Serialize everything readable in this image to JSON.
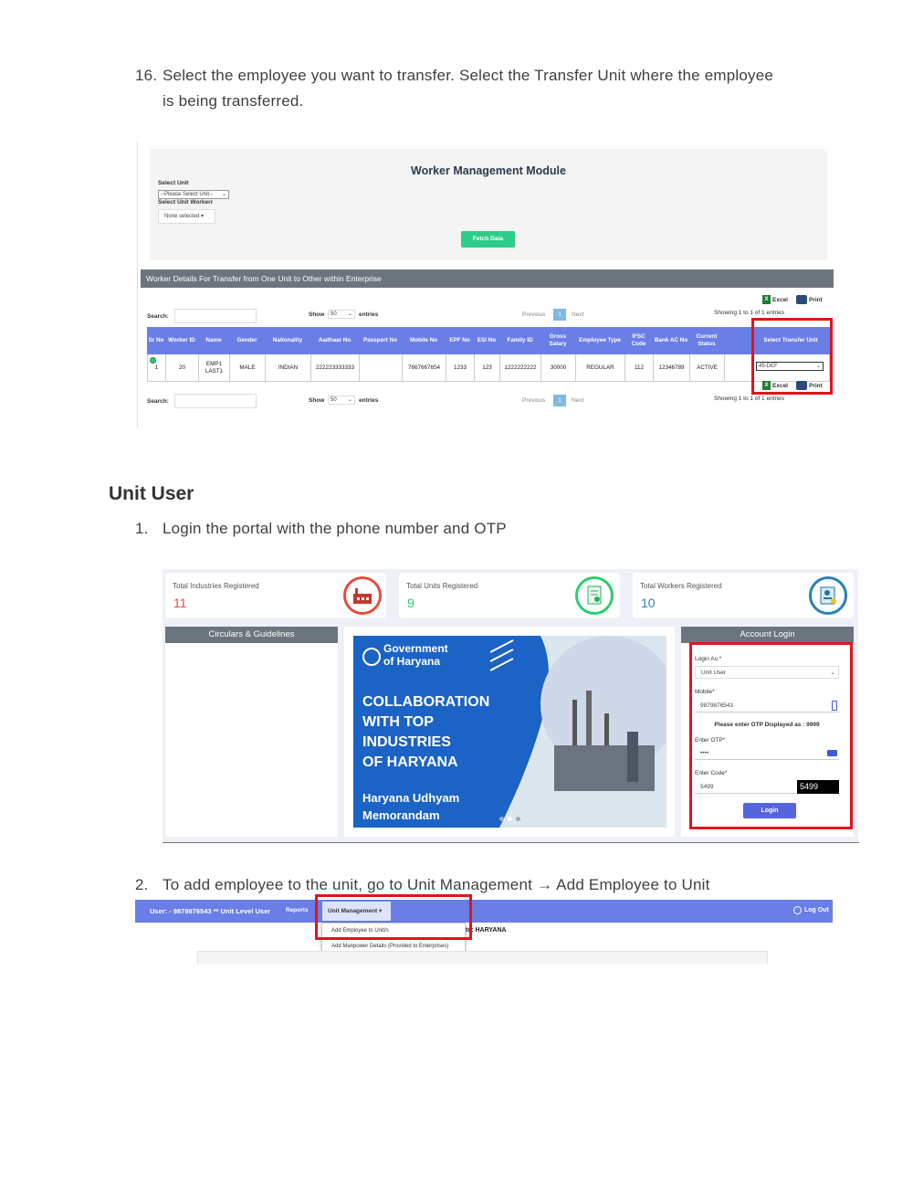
{
  "steps": {
    "step16": {
      "num": "16.",
      "line1": "Select the employee you want to transfer. Select the Transfer Unit where the employee",
      "line2": "is being transferred."
    },
    "section_title": "Unit User",
    "step1": {
      "num": "1.",
      "text": "Login the portal with the phone number and OTP"
    },
    "step2": {
      "num": "2.",
      "text": "To add employee to the unit, go to Unit Management → Add Employee to Unit"
    }
  },
  "wm": {
    "title": "Worker Management Module",
    "select_unit_label": "Select Unit",
    "select_unit_value": "--Please Select Unit--",
    "select_worker_label": "Select Unit Workerr",
    "select_worker_value": "None selected",
    "fetch_button": "Fetch Data",
    "bar_title": "Worker Details For Transfer from One Unit to Other within Enterprise",
    "search_label": "Search:",
    "show_label": "Show",
    "show_value": "50",
    "entries_label": "entries",
    "previous": "Previous",
    "page": "1",
    "next": "Next",
    "showing": "Showing 1 to 1 of 1 entries",
    "excel": "Excel",
    "print": "Print",
    "columns": [
      "Sr No",
      "Worker ID",
      "Name",
      "Gender",
      "Nationality",
      "Aadhaar No",
      "Passport No",
      "Mobile No",
      "EPF No",
      "ESI No",
      "Family ID",
      "Gross Salary",
      "Employee Type",
      "IFSC Code",
      "Bank AC No",
      "Current Status",
      "Select Transfer Unit"
    ],
    "row": [
      "1",
      "20",
      "EMP1 LAST1",
      "MALE",
      "INDIAN",
      "222223333333",
      "",
      "7667667654",
      "1233",
      "123",
      "1222222222",
      "30000",
      "REGULAR",
      "112",
      "12346789",
      "ACTIVE",
      "45-DEF"
    ]
  },
  "login": {
    "cards": [
      {
        "title": "Total Industries Registered",
        "value": "11",
        "color": "#e74c3c",
        "icon": "factory-icon"
      },
      {
        "title": "Total Units Registered",
        "value": "9",
        "color": "#2ecc71",
        "icon": "certificate-icon"
      },
      {
        "title": "Total Workers Registered",
        "value": "10",
        "color": "#2980b9",
        "icon": "worker-id-icon"
      }
    ],
    "circulars_title": "Circulars & Guidelines",
    "banner": {
      "gov_line1": "Government",
      "gov_line2": "of Haryana",
      "headline": [
        "COLLABORATION",
        "WITH TOP",
        "INDUSTRIES",
        "OF HARYANA"
      ],
      "footer_line1": "Haryana Udhyam",
      "footer_line2": "Memorandam"
    },
    "account_title": "Account Login",
    "login_as_label": "Login As:*",
    "login_as_value": "Unit User",
    "mobile_label": "Mobile*",
    "mobile_value": "9879876543",
    "otp_notice": "Please enter OTP Displayed as : 9999",
    "otp_label": "Enter OTP*",
    "otp_value": "••••",
    "code_label": "Enter Code*",
    "code_value": "5499",
    "captcha": "5499",
    "login_button": "Login"
  },
  "nav": {
    "user": "User: - 9879876543 ** Unit Level User",
    "reports": "Reports",
    "unit_mgmt": "Unit Management",
    "logout": "Log Out",
    "state": "te: HARYANA",
    "menu_items": [
      "Add Employee to Unit/s",
      "Add Manpower Details (Provided to Enterprises)"
    ]
  },
  "colors": {
    "accent": "#6a7ee6",
    "highlight": "#e0141e",
    "bar": "#6c757d",
    "green": "#2ecc8a"
  }
}
